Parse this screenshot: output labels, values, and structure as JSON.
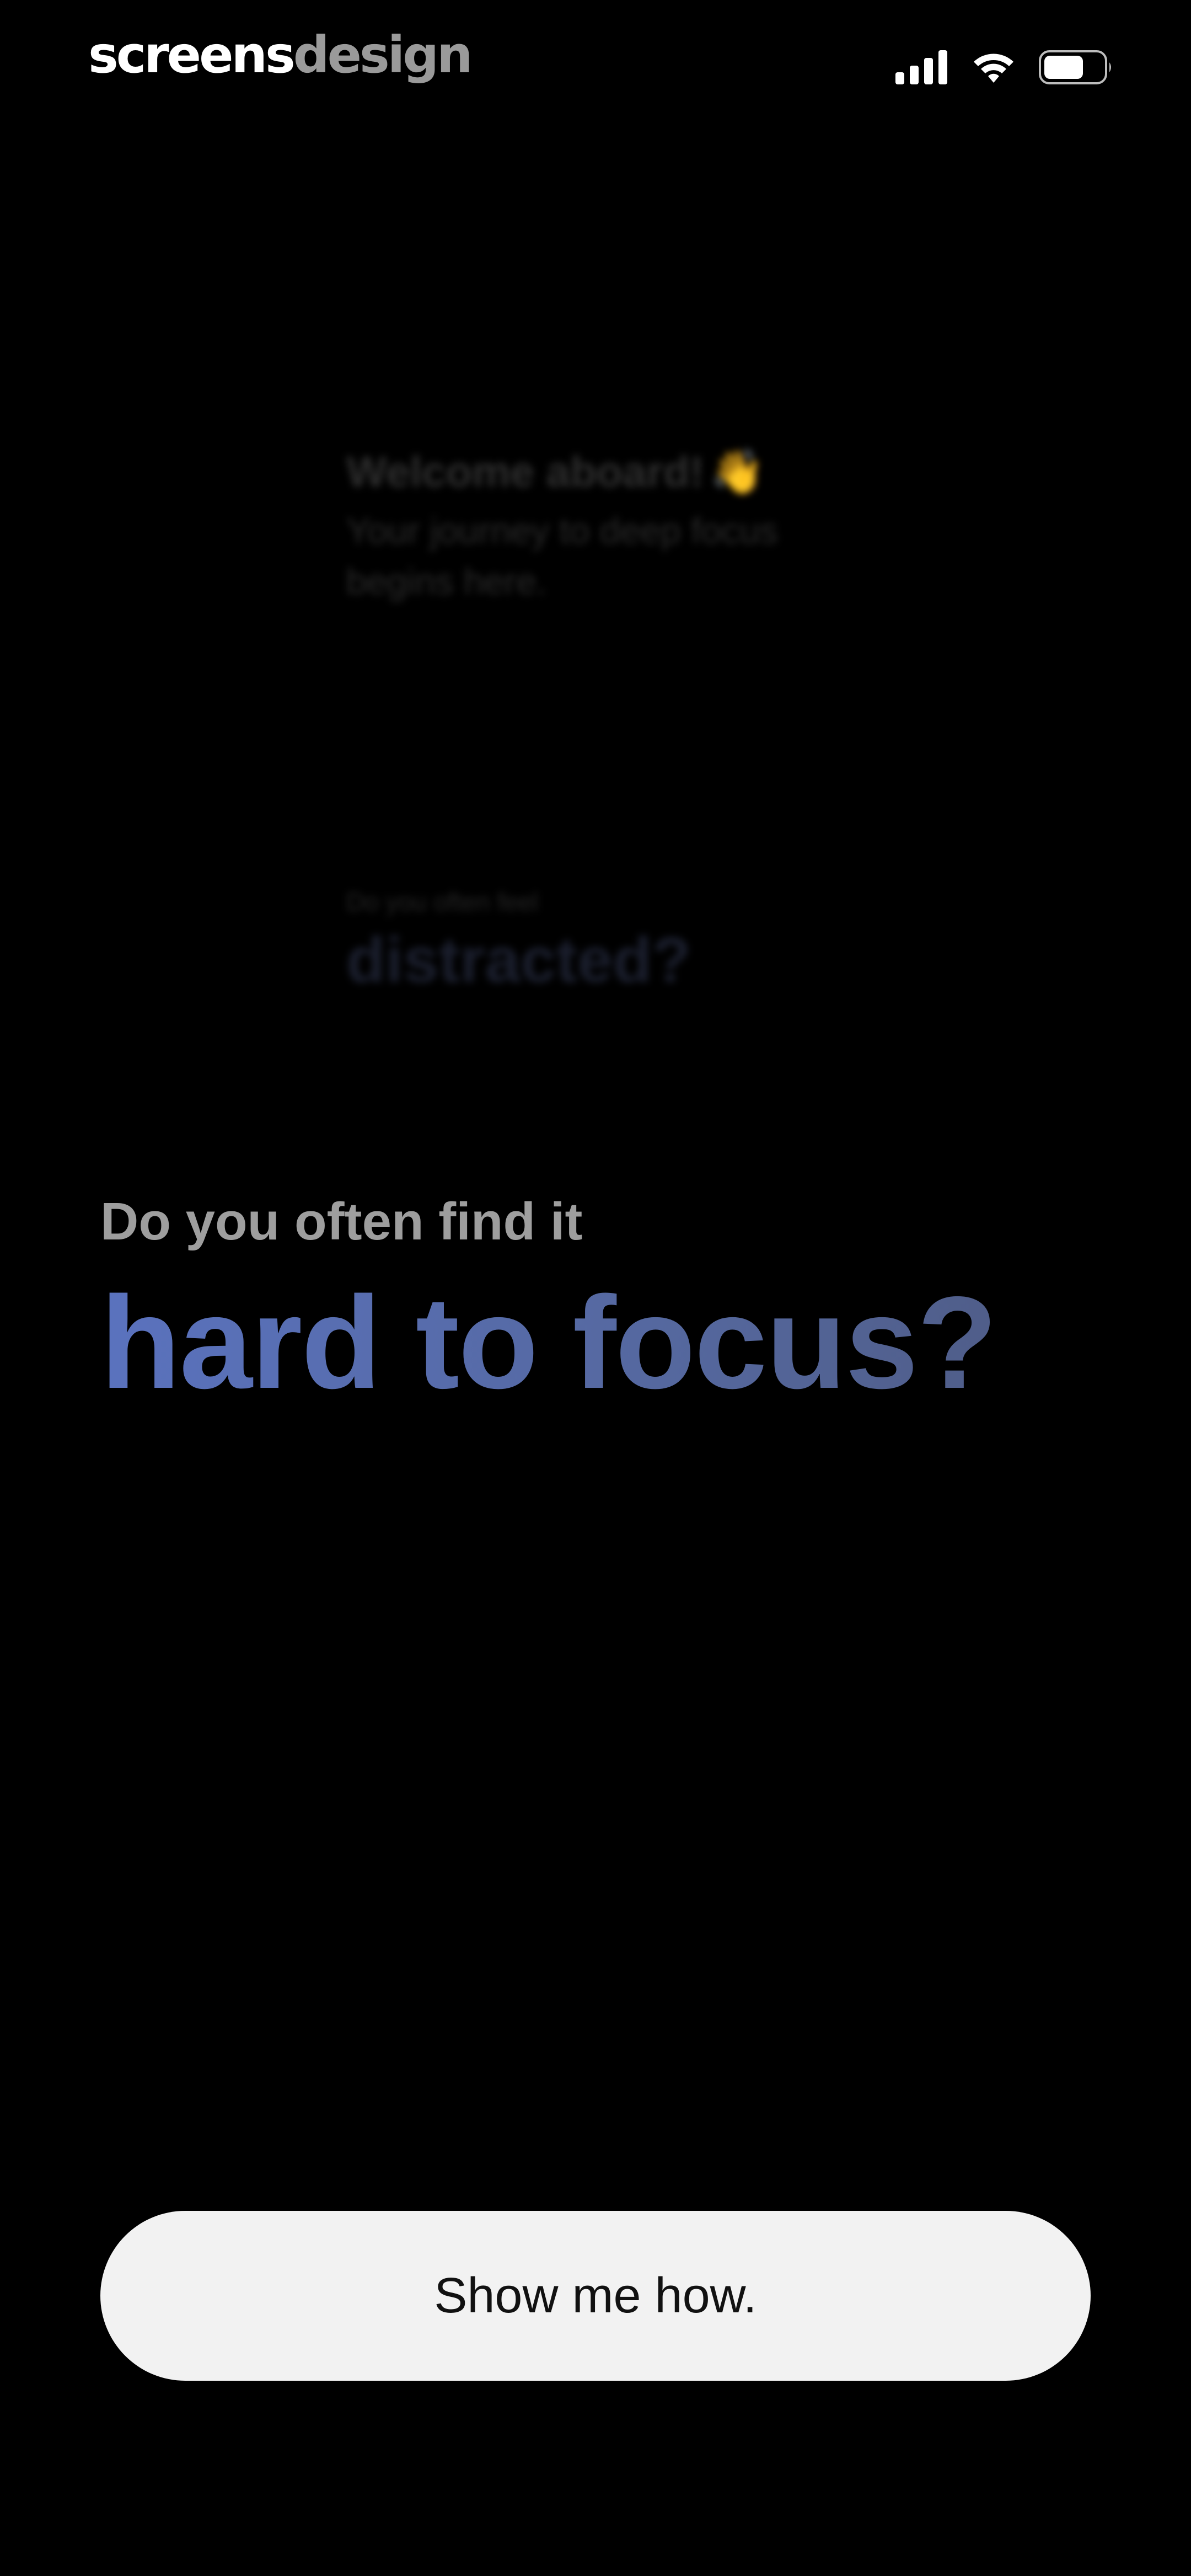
{
  "status_bar": {
    "brand_part1": "screens",
    "brand_part2": "design",
    "icons": [
      "signal-icon",
      "wifi-icon",
      "battery-icon"
    ]
  },
  "previous_cards": {
    "welcome_title": "Welcome aboard!",
    "welcome_emoji": "👋",
    "welcome_subtitle": "Your journey to deep focus begins here.",
    "distracted_small": "Do you often feel",
    "distracted_big": "distracted?"
  },
  "question": {
    "small": "Do you often find it",
    "big": "hard to focus?"
  },
  "cta": {
    "label": "Show me how."
  },
  "colors": {
    "background": "#000000",
    "accent_blue": "#5a72be",
    "button_bg": "#f2f2f2"
  }
}
